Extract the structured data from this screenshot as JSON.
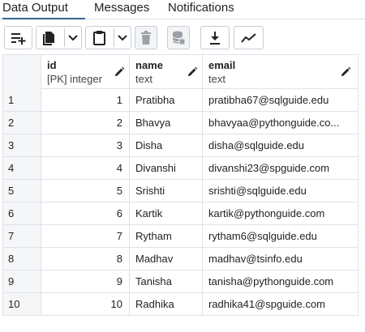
{
  "tabs": [
    {
      "label": "Data Output",
      "active": true
    },
    {
      "label": "Messages",
      "active": false
    },
    {
      "label": "Notifications",
      "active": false
    }
  ],
  "toolbar": {
    "buttons": [
      {
        "name": "add-row-button",
        "icon": "add-row-icon"
      },
      {
        "name": "copy-button",
        "icon": "copy-icon",
        "dropdown": true
      },
      {
        "name": "paste-button",
        "icon": "clipboard-icon",
        "dropdown": true
      },
      {
        "name": "delete-button",
        "icon": "trash-icon",
        "disabled": true
      },
      {
        "name": "save-data-button",
        "icon": "database-save-icon",
        "disabled": true
      },
      {
        "name": "download-button",
        "icon": "download-icon"
      },
      {
        "name": "graph-button",
        "icon": "line-chart-icon"
      }
    ]
  },
  "columns": [
    {
      "name": "id",
      "type": "[PK] integer"
    },
    {
      "name": "name",
      "type": "text"
    },
    {
      "name": "email",
      "type": "text"
    }
  ],
  "rows": [
    {
      "rownum": "1",
      "id": "1",
      "name": "Pratibha",
      "email": "pratibha67@sqlguide.edu"
    },
    {
      "rownum": "2",
      "id": "2",
      "name": "Bhavya",
      "email": "bhavyaa@pythonguide.co..."
    },
    {
      "rownum": "3",
      "id": "3",
      "name": "Disha",
      "email": "disha@sqlguide.edu"
    },
    {
      "rownum": "4",
      "id": "4",
      "name": "Divanshi",
      "email": "divanshi23@spguide.com"
    },
    {
      "rownum": "5",
      "id": "5",
      "name": "Srishti",
      "email": "srishti@sqlguide.edu"
    },
    {
      "rownum": "6",
      "id": "6",
      "name": "Kartik",
      "email": "kartik@pythonguide.com"
    },
    {
      "rownum": "7",
      "id": "7",
      "name": "Rytham",
      "email": "rytham6@sqlguide.edu"
    },
    {
      "rownum": "8",
      "id": "8",
      "name": "Madhav",
      "email": "madhav@tsinfo.edu"
    },
    {
      "rownum": "9",
      "id": "9",
      "name": "Tanisha",
      "email": "tanisha@pythonguide.com"
    },
    {
      "rownum": "10",
      "id": "10",
      "name": "Radhika",
      "email": "radhika41@spguide.com"
    }
  ],
  "colors": {
    "accent": "#326690",
    "border": "#dfe2e7",
    "rownum_bg": "#f5f6f8",
    "icon": "#222222",
    "icon_disabled": "#9aa0a6"
  }
}
